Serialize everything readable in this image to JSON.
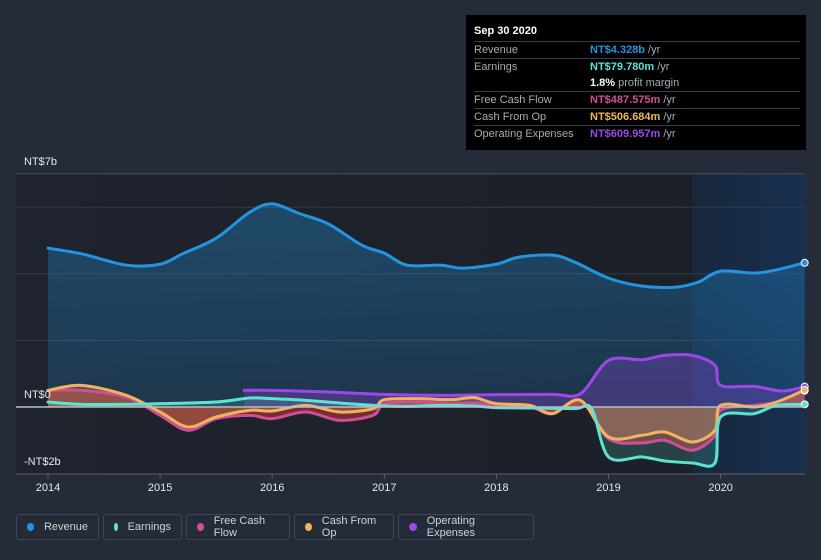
{
  "tooltip": {
    "date": "Sep 30 2020",
    "rows": [
      {
        "label": "Revenue",
        "value": "NT$4.328b",
        "unit": "/yr",
        "color": "#2394df"
      },
      {
        "label": "Earnings",
        "value": "NT$79.780m",
        "unit": "/yr",
        "color": "#5ee2d2"
      },
      {
        "label": "",
        "value": "1.8%",
        "unit": "profit margin",
        "color": "#ffffff"
      },
      {
        "label": "Free Cash Flow",
        "value": "NT$487.575m",
        "unit": "/yr",
        "color": "#d14e96"
      },
      {
        "label": "Cash From Op",
        "value": "NT$506.684m",
        "unit": "/yr",
        "color": "#f0b55c"
      },
      {
        "label": "Operating Expenses",
        "value": "NT$609.957m",
        "unit": "/yr",
        "color": "#9e47e8"
      }
    ]
  },
  "chart_data": {
    "type": "area",
    "title": "",
    "xlabel": "",
    "ylabel": "",
    "y_unit": "NT$ billions",
    "ylim": [
      -2,
      7
    ],
    "y_tick_labels": [
      {
        "value": 7,
        "label": "NT$7b"
      },
      {
        "value": 0,
        "label": "NT$0"
      },
      {
        "value": -2,
        "label": "-NT$2b"
      }
    ],
    "gridlines": [
      6,
      4,
      2
    ],
    "x_ticks": [
      2014,
      2015,
      2016,
      2017,
      2018,
      2019,
      2020
    ],
    "xlim": [
      2013.7,
      2020.77
    ],
    "highlight_start": 2019.75,
    "grid": true,
    "legend_position": "bottom",
    "series": [
      {
        "name": "Revenue",
        "color": "#2394df",
        "x": [
          2014.0,
          2014.3,
          2014.7,
          2015.0,
          2015.2,
          2015.5,
          2015.8,
          2016.0,
          2016.25,
          2016.5,
          2016.8,
          2017.0,
          2017.2,
          2017.5,
          2017.7,
          2018.0,
          2018.2,
          2018.5,
          2018.7,
          2019.0,
          2019.3,
          2019.6,
          2019.8,
          2020.0,
          2020.3,
          2020.5,
          2020.75
        ],
        "values": [
          4.77,
          4.6,
          4.26,
          4.29,
          4.6,
          5.07,
          5.85,
          6.1,
          5.8,
          5.5,
          4.86,
          4.62,
          4.26,
          4.26,
          4.17,
          4.29,
          4.5,
          4.56,
          4.35,
          3.87,
          3.63,
          3.6,
          3.75,
          4.08,
          4.02,
          4.12,
          4.33
        ]
      },
      {
        "name": "Earnings",
        "color": "#5ee2d2",
        "x": [
          2014.0,
          2014.3,
          2014.7,
          2015.0,
          2015.5,
          2015.8,
          2016.0,
          2016.3,
          2016.6,
          2016.9,
          2017.2,
          2017.5,
          2017.8,
          2018.0,
          2018.3,
          2018.7,
          2018.85,
          2019.0,
          2019.3,
          2019.5,
          2019.75,
          2019.95,
          2020.0,
          2020.3,
          2020.5,
          2020.75
        ],
        "values": [
          0.15,
          0.08,
          0.08,
          0.1,
          0.15,
          0.27,
          0.25,
          0.2,
          0.12,
          0.05,
          0.02,
          0.05,
          0.03,
          -0.02,
          -0.03,
          -0.05,
          -0.05,
          -1.5,
          -1.5,
          -1.62,
          -1.68,
          -1.68,
          -0.3,
          -0.2,
          0.05,
          0.08
        ]
      },
      {
        "name": "Free Cash Flow",
        "color": "#d14e96",
        "x": [
          2014.0,
          2014.3,
          2014.7,
          2015.0,
          2015.25,
          2015.5,
          2015.8,
          2016.0,
          2016.3,
          2016.6,
          2016.9,
          2017.0,
          2017.3,
          2017.6,
          2017.8,
          2018.0,
          2018.3,
          2018.5,
          2018.75,
          2019.0,
          2019.3,
          2019.5,
          2019.75,
          2019.95,
          2020.0,
          2020.3,
          2020.5,
          2020.75
        ],
        "values": [
          0.5,
          0.5,
          0.3,
          -0.25,
          -0.7,
          -0.35,
          -0.25,
          -0.35,
          -0.15,
          -0.4,
          -0.25,
          0.1,
          0.15,
          0.1,
          0.12,
          0.05,
          0.0,
          -0.2,
          0.2,
          -0.95,
          -1.08,
          -1.0,
          -1.3,
          -0.85,
          -0.1,
          0.05,
          0.15,
          0.49
        ]
      },
      {
        "name": "Cash From Op",
        "color": "#f0b55c",
        "x": [
          2014.0,
          2014.3,
          2014.7,
          2015.0,
          2015.25,
          2015.5,
          2015.8,
          2016.0,
          2016.3,
          2016.6,
          2016.9,
          2017.0,
          2017.3,
          2017.6,
          2017.8,
          2018.0,
          2018.3,
          2018.5,
          2018.75,
          2019.0,
          2019.3,
          2019.5,
          2019.75,
          2019.95,
          2020.0,
          2020.3,
          2020.5,
          2020.75
        ],
        "values": [
          0.5,
          0.65,
          0.35,
          -0.15,
          -0.6,
          -0.3,
          -0.1,
          -0.12,
          0.05,
          -0.15,
          -0.05,
          0.22,
          0.25,
          0.22,
          0.28,
          0.1,
          0.05,
          -0.2,
          0.2,
          -0.9,
          -0.85,
          -0.75,
          -1.05,
          -0.7,
          0.05,
          0.0,
          0.15,
          0.51
        ]
      },
      {
        "name": "Operating Expenses",
        "color": "#9e47e8",
        "x": [
          2015.75,
          2016.0,
          2016.5,
          2017.0,
          2017.5,
          2018.0,
          2018.5,
          2018.75,
          2019.0,
          2019.3,
          2019.5,
          2019.75,
          2019.95,
          2020.0,
          2020.3,
          2020.55,
          2020.75
        ],
        "values": [
          0.5,
          0.5,
          0.45,
          0.38,
          0.35,
          0.37,
          0.38,
          0.4,
          1.4,
          1.42,
          1.55,
          1.55,
          1.25,
          0.65,
          0.62,
          0.48,
          0.61
        ]
      }
    ]
  },
  "legend": [
    {
      "label": "Revenue",
      "color": "#2394df"
    },
    {
      "label": "Earnings",
      "color": "#5ee2d2"
    },
    {
      "label": "Free Cash Flow",
      "color": "#d14e96"
    },
    {
      "label": "Cash From Op",
      "color": "#f0b55c"
    },
    {
      "label": "Operating Expenses",
      "color": "#9e47e8"
    }
  ]
}
